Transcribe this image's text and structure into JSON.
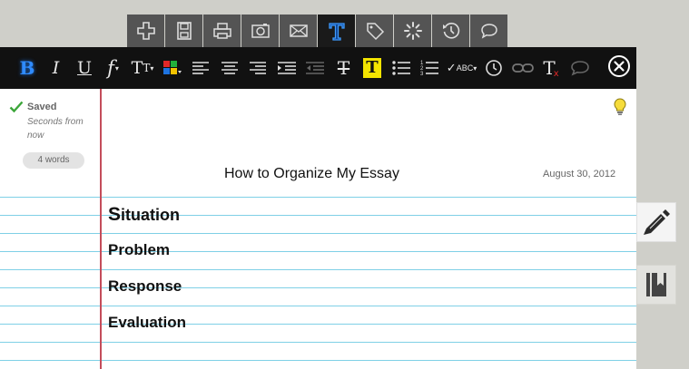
{
  "tabs": [
    {
      "icon": "plus-icon"
    },
    {
      "icon": "save-icon"
    },
    {
      "icon": "print-icon"
    },
    {
      "icon": "camera-icon"
    },
    {
      "icon": "mail-icon"
    },
    {
      "icon": "text-style-icon",
      "active": true
    },
    {
      "icon": "tag-icon"
    },
    {
      "icon": "loading-icon"
    },
    {
      "icon": "history-icon"
    },
    {
      "icon": "comment-icon"
    }
  ],
  "toolbar": {
    "bold": "B",
    "italic": "I",
    "underline": "U",
    "font": "f",
    "size": "T",
    "strike": "T",
    "highlight": "T",
    "clear": "T",
    "spell": "ABC",
    "accent_color": "#1e73e0",
    "highlight_color": "#f3e400"
  },
  "status": {
    "saved_label": "Saved",
    "saved_detail": "Seconds from now",
    "word_count": "4 words"
  },
  "document": {
    "title": "How to Organize My Essay",
    "date": "August 30, 2012",
    "lines": [
      {
        "first": "S",
        "rest": "ituation"
      },
      {
        "text": "Problem"
      },
      {
        "text": "Response"
      },
      {
        "text": "Evaluation"
      }
    ]
  }
}
